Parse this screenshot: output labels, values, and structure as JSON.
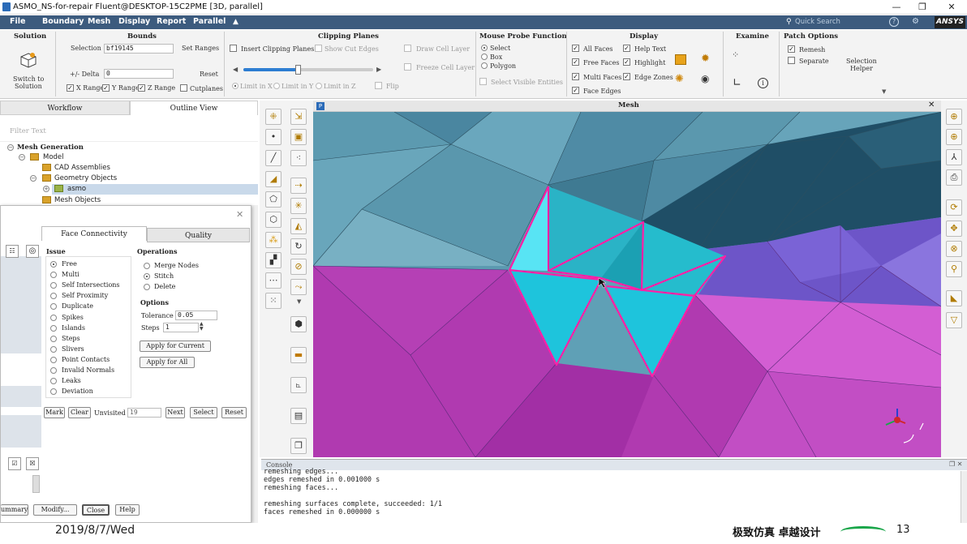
{
  "window": {
    "title": "ASMO_NS-for-repair Fluent@DESKTOP-15C2PME  [3D, parallel]",
    "min": "—",
    "max": "❐",
    "close": "✕"
  },
  "menu": [
    "File",
    "Boundary",
    "Mesh",
    "Display",
    "Report",
    "Parallel"
  ],
  "quick_search": "Quick Search",
  "brand": "ANSYS",
  "ribbon": {
    "solution": {
      "title": "Solution",
      "switch_label_1": "Switch to",
      "switch_label_2": "Solution"
    },
    "bounds": {
      "title": "Bounds",
      "selection_label": "Selection",
      "selection_value": "bf19145",
      "set_ranges": "Set Ranges",
      "delta_label": "+/- Delta",
      "delta_value": "0",
      "reset": "Reset",
      "x_range": "X Range",
      "y_range": "Y Range",
      "z_range": "Z Range",
      "cutplanes": "Cutplanes"
    },
    "clipping": {
      "title": "Clipping Planes",
      "insert": "Insert Clipping Planes",
      "show_cut_edges": "Show Cut Edges",
      "draw_cell_layer": "Draw Cell Layer",
      "freeze_cell_layer": "Freeze Cell Layer",
      "limit_x": "Limit in X",
      "limit_y": "Limit in Y",
      "limit_z": "Limit in Z",
      "flip": "Flip",
      "slider_value": 0.42
    },
    "mouse_probe": {
      "title": "Mouse Probe Function",
      "select": "Select",
      "box": "Box",
      "polygon": "Polygon",
      "select_visible": "Select Visible Entities"
    },
    "display": {
      "title": "Display",
      "all_faces": "All Faces",
      "free_faces": "Free Faces",
      "multi_faces": "Multi Faces",
      "face_edges": "Face Edges",
      "help_text": "Help Text",
      "highlight": "Highlight",
      "edge_zones": "Edge Zones"
    },
    "examine": {
      "title": "Examine"
    },
    "patch": {
      "title": "Patch Options",
      "remesh": "Remesh",
      "separate": "Separate",
      "selection_helper_1": "Selection",
      "selection_helper_2": "Helper"
    }
  },
  "left_tabs": {
    "workflow": "Workflow",
    "outline": "Outline View"
  },
  "filter_placeholder": "Filter Text",
  "tree": {
    "root": "Mesh Generation",
    "model": "Model",
    "cad": "CAD Assemblies",
    "geom": "Geometry Objects",
    "asmo": "asmo",
    "mesh_objects": "Mesh Objects"
  },
  "dialog": {
    "tab_face": "Face Connectivity",
    "tab_quality": "Quality",
    "issue_title": "Issue",
    "issues": [
      "Free",
      "Multi",
      "Self Intersections",
      "Self Proximity",
      "Duplicate",
      "Spikes",
      "Islands",
      "Steps",
      "Slivers",
      "Point Contacts",
      "Invalid Normals",
      "Leaks",
      "Deviation"
    ],
    "operations_title": "Operations",
    "operations": [
      "Merge Nodes",
      "Stitch",
      "Delete"
    ],
    "options_title": "Options",
    "tolerance_label": "Tolerance",
    "tolerance_value": "0.05",
    "steps_label": "Steps",
    "steps_value": "1",
    "apply_current": "Apply for Current",
    "apply_all": "Apply for All",
    "mark": "Mark",
    "clear": "Clear",
    "unvisited_label": "Unvisited",
    "unvisited_value": "19",
    "next": "Next",
    "select": "Select",
    "reset": "Reset",
    "summary": "ummary",
    "modify": "Modify...",
    "close": "Close",
    "help": "Help"
  },
  "viewport": {
    "title": "Mesh",
    "tag": "P"
  },
  "console": {
    "title": "Console",
    "lines": [
      "remeshing edges...",
      "edges remeshed in 0.001000 s",
      "remeshing faces...",
      "",
      "remeshing surfaces complete, succeeded: 1/1",
      "faces remeshed in 0.000000 s"
    ]
  },
  "footer": {
    "date": "2019/8/7/Wed",
    "slogan": "极致仿真 卓越设计",
    "page": "13"
  },
  "colors": {
    "menubar": "#3c5b7e",
    "highlight": "#ff1fa6",
    "magenta_mesh": "#b03ab0",
    "blue_mesh": "#5fa0b6",
    "cyan_face": "#1ec4dc"
  }
}
